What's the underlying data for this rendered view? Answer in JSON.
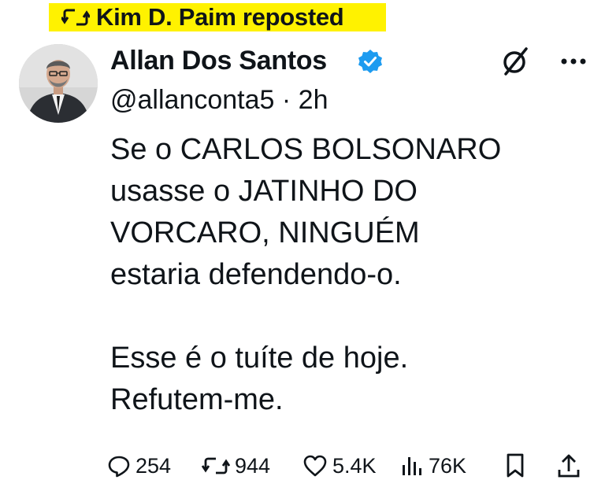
{
  "repost": {
    "label": "Kim D. Paim reposted"
  },
  "author": {
    "name": "Allan Dos Santos",
    "handle": "@allanconta5",
    "separator": "·",
    "time": "2h",
    "verified": true
  },
  "tweet": {
    "text": "Se o CARLOS BOLSONARO\nusasse o JATINHO DO\nVORCARO, NINGUÉM\nestaria defendendo-o.\n\nEsse é o tuíte de hoje.\nRefutem-me."
  },
  "actions": {
    "replies": "254",
    "reposts": "944",
    "likes": "5.4K",
    "views": "76K"
  },
  "colors": {
    "highlight": "#fff200",
    "verified": "#1d9bf0",
    "text": "#0f1419"
  },
  "icons": {
    "repost": "repost-icon",
    "verified": "verified-badge-icon",
    "grok": "grok-icon",
    "more": "more-icon",
    "reply": "reply-icon",
    "retweet": "retweet-icon",
    "like": "heart-icon",
    "views": "views-icon",
    "bookmark": "bookmark-icon",
    "share": "share-icon"
  }
}
